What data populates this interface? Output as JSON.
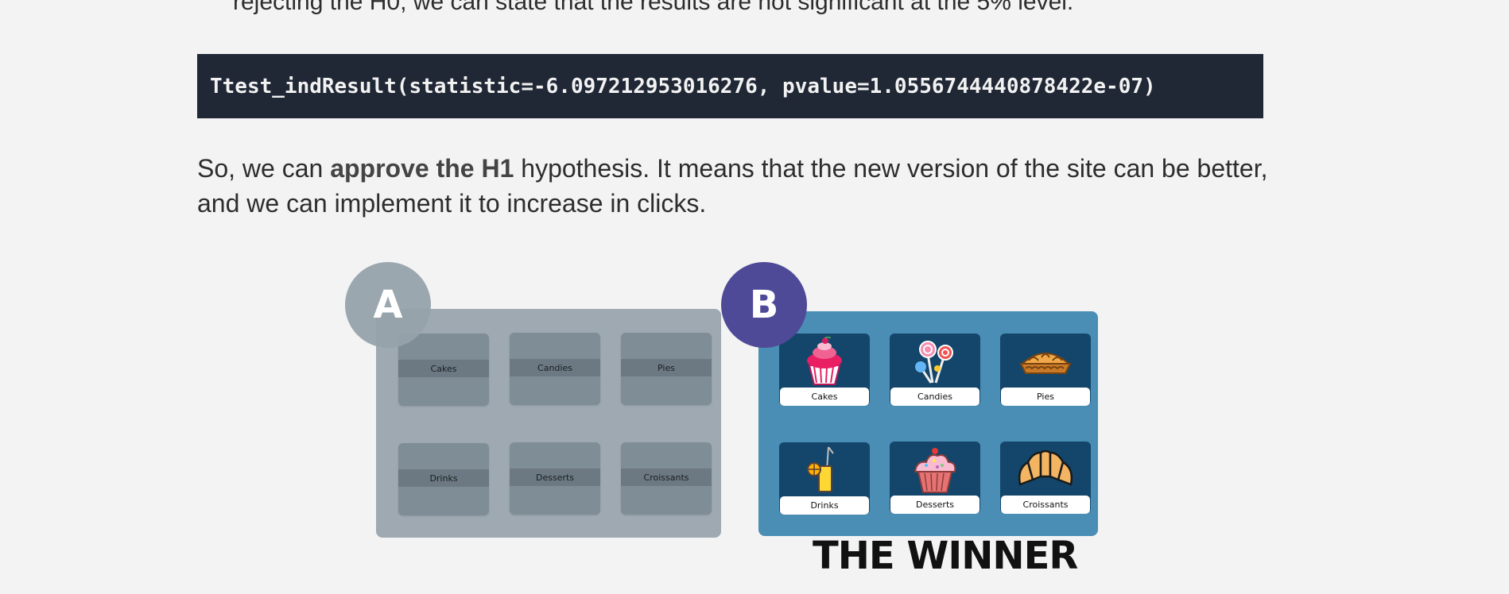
{
  "article": {
    "top_line": "rejecting the H0, we can state that the results are not significant at the 5% level.",
    "code": "Ttest_indResult(statistic=-6.097212953016276, pvalue=1.0556744440878422e-07)",
    "para_before": "So, we can ",
    "para_bold": "approve the H1",
    "para_after": " hypothesis. It means that the new version of the site can be better, and we can implement it to increase in clicks."
  },
  "figure": {
    "variant_a": {
      "badge": "A",
      "tiles": [
        "Cakes",
        "Candies",
        "Pies",
        "Drinks",
        "Desserts",
        "Croissants"
      ]
    },
    "variant_b": {
      "badge": "B",
      "tiles": [
        {
          "label": "Cakes",
          "icon": "cupcake-icon"
        },
        {
          "label": "Candies",
          "icon": "lollipops-icon"
        },
        {
          "label": "Pies",
          "icon": "pie-icon"
        },
        {
          "label": "Drinks",
          "icon": "drink-icon"
        },
        {
          "label": "Desserts",
          "icon": "muffin-icon"
        },
        {
          "label": "Croissants",
          "icon": "croissant-icon"
        }
      ]
    },
    "caption": "THE WINNER"
  },
  "colors": {
    "page_bg": "#f3f3f3",
    "code_bg": "#202735",
    "panel_a": "#9ea9b2",
    "panel_b": "#4a8db5",
    "badge_b": "#4f4a98"
  }
}
